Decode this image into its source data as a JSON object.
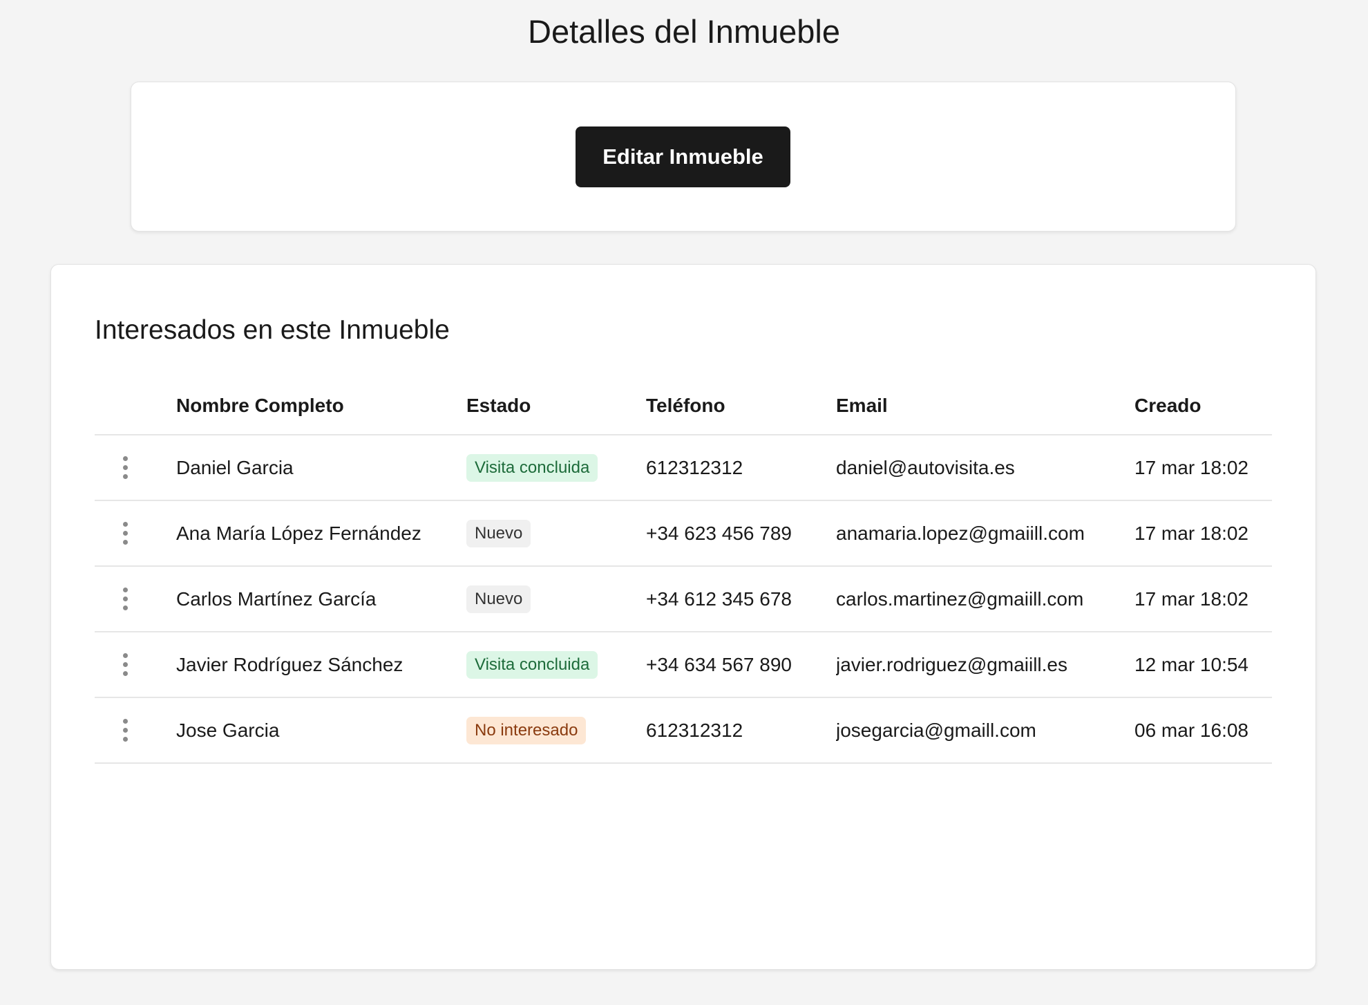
{
  "page": {
    "title": "Detalles del Inmueble"
  },
  "actions": {
    "edit_label": "Editar Inmueble"
  },
  "leads": {
    "title": "Interesados en este Inmueble",
    "columns": [
      "Nombre Completo",
      "Estado",
      "Teléfono",
      "Email",
      "Creado"
    ],
    "rows": [
      {
        "name": "Daniel Garcia",
        "status": "Visita concluida",
        "status_color": "green",
        "phone": "612312312",
        "email": "daniel@autovisita.es",
        "created": "17 mar 18:02"
      },
      {
        "name": "Ana María López Fernández",
        "status": "Nuevo",
        "status_color": "gray",
        "phone": "+34 623 456 789",
        "email": "anamaria.lopez@gmaiill.com",
        "created": "17 mar 18:02"
      },
      {
        "name": "Carlos Martínez García",
        "status": "Nuevo",
        "status_color": "gray",
        "phone": "+34 612 345 678",
        "email": "carlos.martinez@gmaiill.com",
        "created": "17 mar 18:02"
      },
      {
        "name": "Javier Rodríguez Sánchez",
        "status": "Visita concluida",
        "status_color": "green",
        "phone": "+34 634 567 890",
        "email": "javier.rodriguez@gmaiill.es",
        "created": "12 mar 10:54"
      },
      {
        "name": "Jose Garcia",
        "status": "No interesado",
        "status_color": "orange",
        "phone": "612312312",
        "email": "josegarcia@gmaill.com",
        "created": "06 mar 16:08"
      }
    ]
  },
  "colors": {
    "background": "#f4f4f4",
    "button": "#1a1a1a",
    "badge_green_bg": "#dcf6e6",
    "badge_gray_bg": "#f0f0f0",
    "badge_orange_bg": "#fde7d4"
  },
  "icons": {
    "row_menu": "kebab-menu-icon"
  }
}
